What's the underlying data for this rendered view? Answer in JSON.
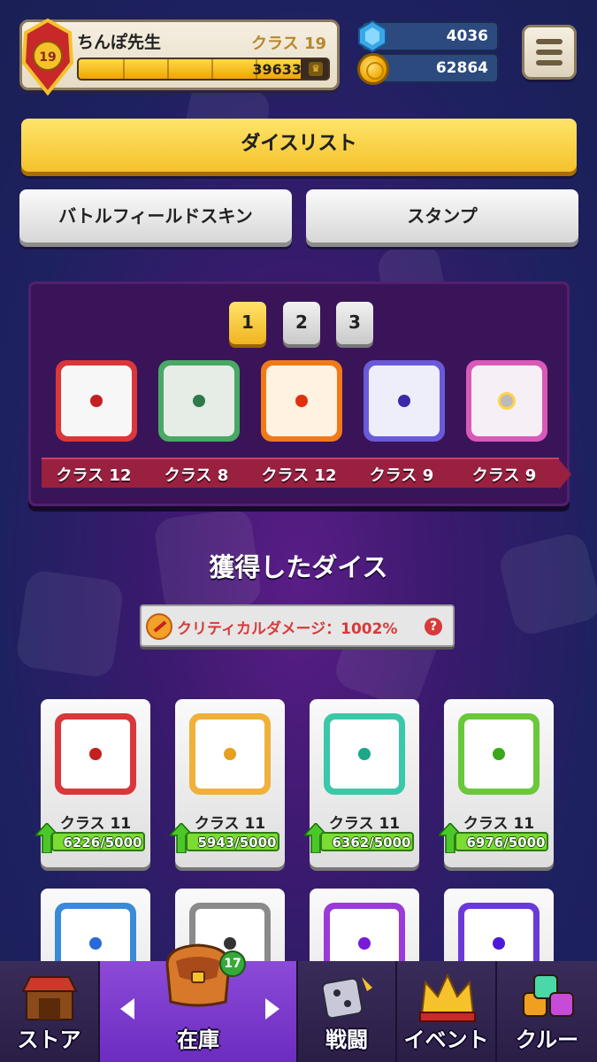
{
  "header": {
    "player_name": "ちんぽ先生",
    "class_label": "クラス 19",
    "emblem_level": "19",
    "xp_value": "39633",
    "xp_progress": 0.89,
    "gems": "4036",
    "coins": "62864"
  },
  "buttons": {
    "dice_list": "ダイスリスト",
    "battlefield_skin": "バトルフィールドスキン",
    "stamp": "スタンプ"
  },
  "deck": {
    "tabs": [
      "1",
      "2",
      "3"
    ],
    "active_tab": "1",
    "dice": [
      {
        "label": "クラス 12",
        "color": "#d9373a",
        "dot": "#c42020"
      },
      {
        "label": "クラス 8",
        "color": "#4aa865",
        "dot": "#2e7a4a"
      },
      {
        "label": "クラス 12",
        "color": "#f07a1a",
        "dot": "#e03010"
      },
      {
        "label": "クラス 9",
        "color": "#6a5ad8",
        "dot": "#3a2aa8"
      },
      {
        "label": "クラス 9",
        "color": "#d85ab8",
        "dot": "#e0e0e0"
      }
    ]
  },
  "acquired": {
    "title": "獲得したダイス",
    "crit_text": "クリティカルダメージ：1002%",
    "help": "?",
    "cards": [
      {
        "label": "クラス 11",
        "progress": "6226/5000",
        "color": "#d9373a",
        "dot": "#c42020"
      },
      {
        "label": "クラス 11",
        "progress": "5943/5000",
        "color": "#f0b03a",
        "dot": "#e8a020"
      },
      {
        "label": "クラス 11",
        "progress": "6362/5000",
        "color": "#3ac8a8",
        "dot": "#1aa888"
      },
      {
        "label": "クラス 11",
        "progress": "6976/5000",
        "color": "#6ac83a",
        "dot": "#3aa81a"
      },
      {
        "label": "",
        "progress": "",
        "color": "#3a8ad8",
        "dot": "#2a6ad8"
      },
      {
        "label": "",
        "progress": "",
        "color": "#8a8a8a",
        "dot": "#333333"
      },
      {
        "label": "",
        "progress": "",
        "color": "#9a3ad8",
        "dot": "#7a1ad8"
      },
      {
        "label": "",
        "progress": "",
        "color": "#6a3ad8",
        "dot": "#4a1ad8"
      }
    ]
  },
  "nav": {
    "store": "ストア",
    "inventory": "在庫",
    "inventory_badge": "17",
    "battle": "戦闘",
    "event": "イベント",
    "crew": "クルー"
  },
  "colors": {
    "accent_yellow": "#f5c22b",
    "active_nav": "#7a3acc",
    "ribbon": "#9a2040"
  }
}
